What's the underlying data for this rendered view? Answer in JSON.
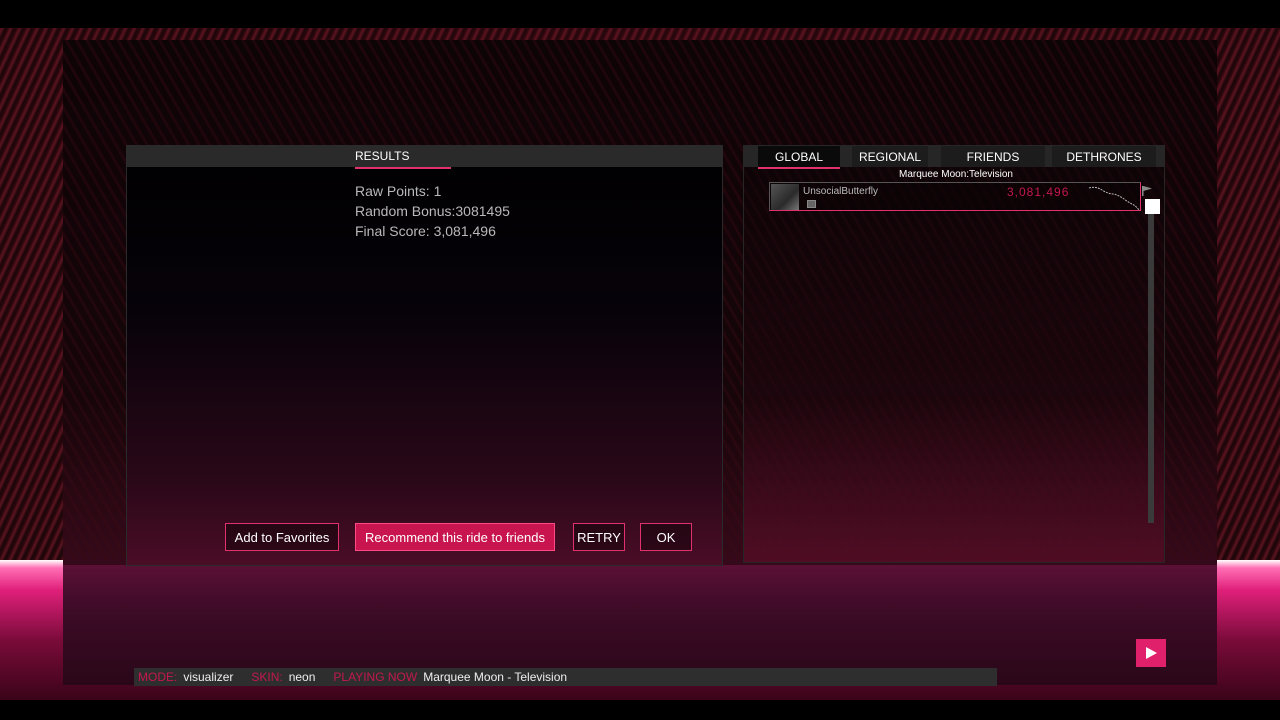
{
  "results": {
    "tab_label": "RESULTS",
    "raw_points": "Raw Points: 1",
    "random_bonus": "Random Bonus:3081495",
    "final_score": "Final Score: 3,081,496",
    "buttons": {
      "favorites": "Add to Favorites",
      "recommend": "Recommend this ride to friends",
      "retry": "RETRY",
      "ok": "OK"
    }
  },
  "leaderboard": {
    "tabs": [
      "GLOBAL",
      "REGIONAL",
      "FRIENDS",
      "DETHRONES"
    ],
    "active_tab": "GLOBAL",
    "song_title": "Marquee Moon:Television",
    "entries": [
      {
        "player": "UnsocialButterfly",
        "score": "3,081,496"
      }
    ]
  },
  "status_bar": {
    "mode_label": "MODE:",
    "mode_value": "visualizer",
    "skin_label": "SKIN:",
    "skin_value": "neon",
    "playing_label": "PLAYING NOW",
    "playing_value": "Marquee Moon - Television"
  },
  "colors": {
    "accent": "#e0306e",
    "button_fill": "#c8144f",
    "score_text": "#c4174f"
  },
  "icons": {
    "play": "play-icon",
    "flag": "flag-icon"
  }
}
